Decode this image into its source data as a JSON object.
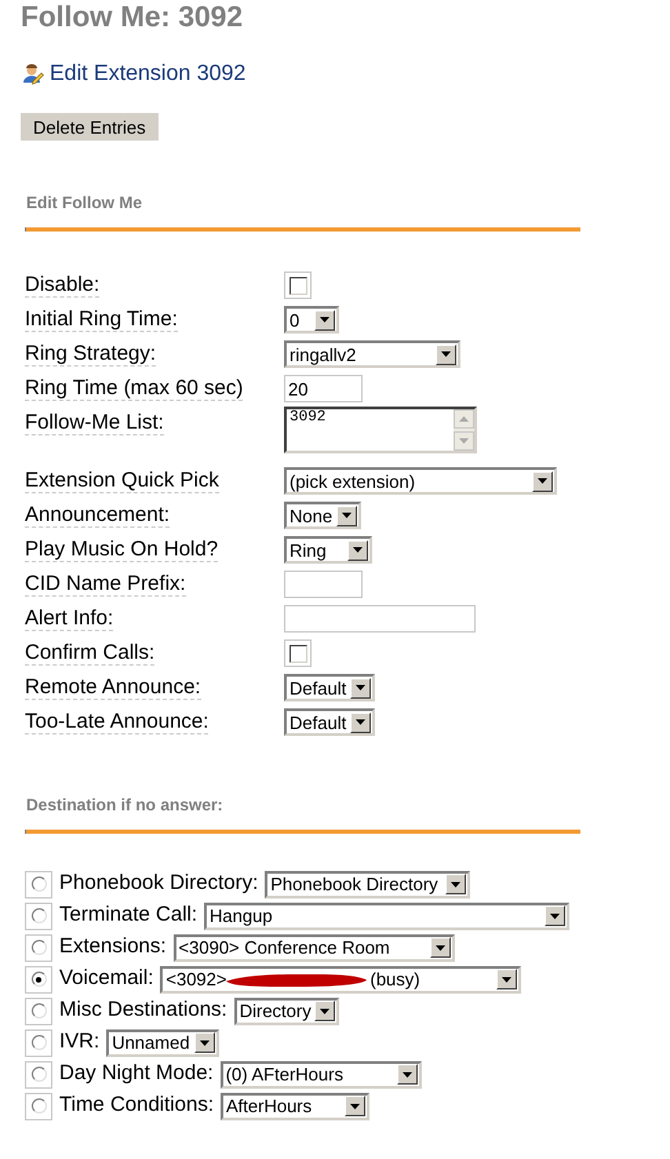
{
  "title": "Follow Me: 3092",
  "edit_link": "Edit Extension 3092",
  "delete_button": "Delete Entries",
  "section_1": "Edit Follow Me",
  "fields": [
    {
      "kind": "checkbox",
      "label": "Disable:",
      "checked": false
    },
    {
      "kind": "select",
      "label": "Initial Ring Time:",
      "value": "0"
    },
    {
      "kind": "select",
      "label": "Ring Strategy:",
      "value": "ringallv2"
    },
    {
      "kind": "text",
      "label": "Ring Time (max 60 sec)",
      "value": "20"
    },
    {
      "kind": "textarea",
      "label": "Follow-Me List:",
      "value": "3092"
    },
    {
      "kind": "select",
      "label": "Extension Quick Pick",
      "value": "(pick extension)"
    },
    {
      "kind": "select",
      "label": "Announcement:",
      "value": "None"
    },
    {
      "kind": "select",
      "label": "Play Music On Hold?",
      "value": "Ring"
    },
    {
      "kind": "text",
      "label": "CID Name Prefix:"
    },
    {
      "kind": "text",
      "label": "Alert Info:"
    },
    {
      "kind": "checkbox",
      "label": "Confirm Calls:",
      "checked": false
    },
    {
      "kind": "select",
      "label": "Remote Announce:",
      "value": "Default"
    },
    {
      "kind": "select",
      "label": "Too-Late Announce:",
      "value": "Default"
    }
  ],
  "section_2": "Destination if no answer:",
  "destinations": [
    {
      "label": "Phonebook Directory:",
      "value": "Phonebook Directory",
      "selected": false
    },
    {
      "label": "Terminate Call:",
      "value": "Hangup",
      "selected": false
    },
    {
      "label": "Extensions:",
      "value": "<3090> Conference Room",
      "selected": false
    },
    {
      "label": "Voicemail:",
      "value": "<3092>",
      "redacted": true,
      "value_after": "(busy)",
      "selected": true
    },
    {
      "label": "Misc Destinations:",
      "value": "Directory",
      "selected": false
    },
    {
      "label": "IVR:",
      "value": "Unnamed",
      "selected": false
    },
    {
      "label": "Day Night Mode:",
      "value": "(0) AFterHours",
      "selected": false
    },
    {
      "label": "Time Conditions:",
      "value": "AfterHours",
      "selected": false
    }
  ]
}
